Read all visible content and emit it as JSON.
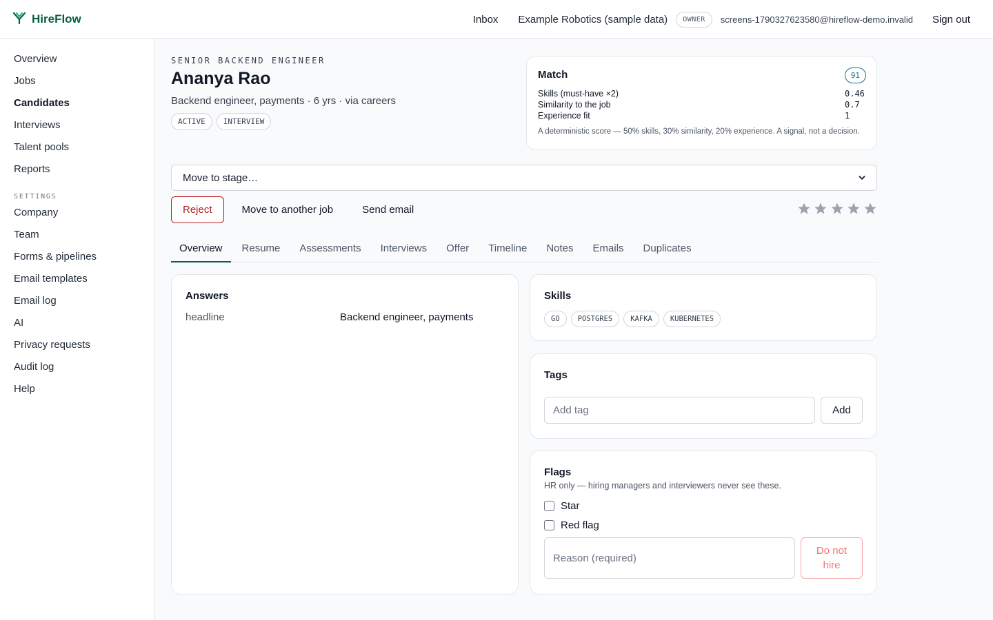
{
  "app": {
    "name": "HireFlow",
    "brand_color": "#065f46"
  },
  "topbar": {
    "inbox_label": "Inbox",
    "org_name": "Example Robotics (sample data)",
    "role_badge": "OWNER",
    "user_email": "screens-1790327623580@hireflow-demo.invalid",
    "sign_out_label": "Sign out"
  },
  "sidebar": {
    "items": [
      {
        "label": "Overview"
      },
      {
        "label": "Jobs"
      },
      {
        "label": "Candidates",
        "active": true
      },
      {
        "label": "Interviews"
      },
      {
        "label": "Talent pools"
      },
      {
        "label": "Reports"
      }
    ],
    "settings_heading": "SETTINGS",
    "settings_items": [
      {
        "label": "Company"
      },
      {
        "label": "Team"
      },
      {
        "label": "Forms & pipelines"
      },
      {
        "label": "Email templates"
      },
      {
        "label": "Email log"
      },
      {
        "label": "AI"
      },
      {
        "label": "Privacy requests"
      },
      {
        "label": "Audit log"
      },
      {
        "label": "Help"
      }
    ]
  },
  "candidate": {
    "job_title": "SENIOR BACKEND ENGINEER",
    "name": "Ananya Rao",
    "subtitle": "Backend engineer, payments · 6 yrs · via careers",
    "status_pills": [
      "ACTIVE",
      "INTERVIEW"
    ]
  },
  "match": {
    "title": "Match",
    "score": "91",
    "rows": [
      {
        "label": "Skills (must-have ×2)",
        "value": "0.46"
      },
      {
        "label": "Similarity to the job",
        "value": "0.7"
      },
      {
        "label": "Experience fit",
        "value": "1"
      }
    ],
    "note": "A deterministic score — 50% skills, 30% similarity, 20% experience. A signal, not a decision."
  },
  "stage_select": {
    "value": "Move to stage…"
  },
  "actions": {
    "reject_label": "Reject",
    "move_job_label": "Move to another job",
    "send_email_label": "Send email"
  },
  "rating": {
    "max": 5,
    "value": 0,
    "star_color": "#9ca3af"
  },
  "tabs": [
    {
      "label": "Overview",
      "active": true
    },
    {
      "label": "Resume"
    },
    {
      "label": "Assessments"
    },
    {
      "label": "Interviews"
    },
    {
      "label": "Offer"
    },
    {
      "label": "Timeline"
    },
    {
      "label": "Notes"
    },
    {
      "label": "Emails"
    },
    {
      "label": "Duplicates"
    }
  ],
  "answers": {
    "title": "Answers",
    "rows": [
      {
        "key": "headline",
        "value": "Backend engineer, payments"
      }
    ]
  },
  "skills": {
    "title": "Skills",
    "items": [
      "GO",
      "POSTGRES",
      "KAFKA",
      "KUBERNETES"
    ]
  },
  "tags": {
    "title": "Tags",
    "input_placeholder": "Add tag",
    "add_label": "Add"
  },
  "flags": {
    "title": "Flags",
    "note": "HR only — hiring managers and interviewers never see these.",
    "star_label": "Star",
    "red_flag_label": "Red flag",
    "reason_placeholder": "Reason (required)",
    "do_not_hire_label": "Do not hire"
  }
}
